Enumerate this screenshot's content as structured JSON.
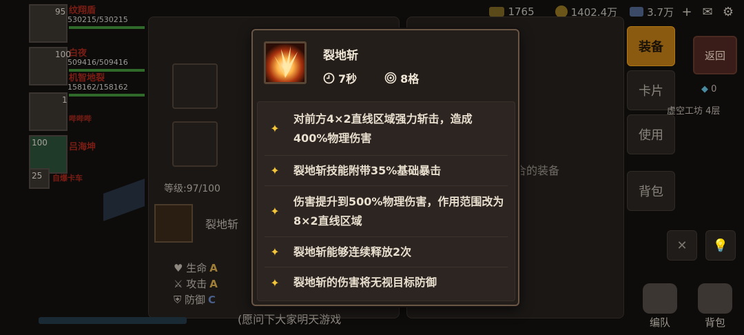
{
  "resources": {
    "stamina": "1765",
    "gold": "1402.4万",
    "diamond": "3.7万",
    "plus": "+"
  },
  "team": [
    {
      "level": "95",
      "name": "纹翔盾",
      "hp": "530215/530215"
    },
    {
      "level": "100",
      "name": "白夜",
      "hp": "509416/509416"
    },
    {
      "level": "",
      "name": "机智地裂",
      "hp": "158162/158162"
    },
    {
      "level": "1",
      "name": "哔哔哔",
      "hp": ""
    },
    {
      "level": "100",
      "name": "吕海坤",
      "hp": ""
    },
    {
      "level": "25",
      "name": "自爆卡车",
      "hp": ""
    }
  ],
  "equip_panel": {
    "level_label": "等级:97/100",
    "skill_name": "裂地斩",
    "stats": [
      {
        "label": "生命",
        "grade": "A"
      },
      {
        "label": "攻击",
        "grade": "A"
      },
      {
        "label": "防御",
        "grade": "C"
      }
    ]
  },
  "chat_text": "(愿问下大家明天游戏",
  "right_panel": {
    "hint": "合的装备"
  },
  "side_tabs": [
    "装备",
    "卡片",
    "使用",
    "背包"
  ],
  "back_label": "返回",
  "gem_count": "0",
  "floor_label": "虚空工坊 4层",
  "bottom_buttons": [
    "编队",
    "背包"
  ],
  "popup": {
    "title": "裂地斩",
    "cooldown": "7秒",
    "range": "8格",
    "entries": [
      "对前方4×2直线区域强力斩击，造成400%物理伤害",
      "裂地斩技能附带35%基础暴击",
      "伤害提升到500%物理伤害，作用范围改为8×2直线区域",
      "裂地斩能够连续释放2次",
      "裂地斩的伤害将无视目标防御"
    ]
  },
  "colors": {
    "accent_gold": "#f3c53a",
    "tab_active": "#8a5a10",
    "popup_border": "#6a5644"
  }
}
